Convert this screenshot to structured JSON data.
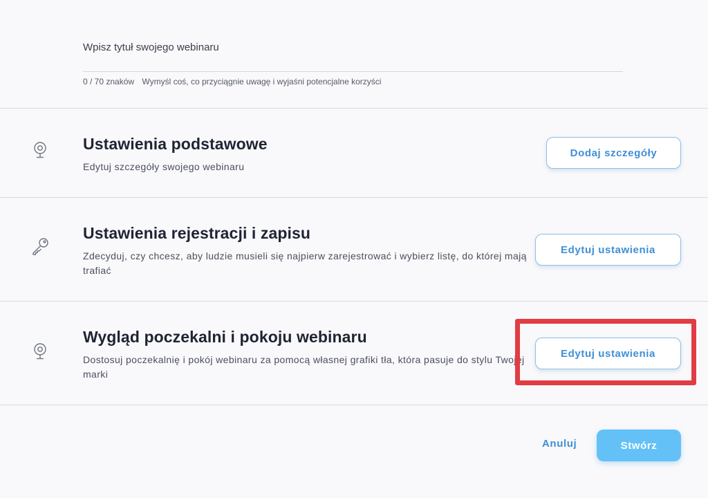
{
  "title_input": {
    "placeholder": "Wpisz tytuł swojego webinaru",
    "value": "",
    "counter": "0 / 70 znaków",
    "hint": "Wymyśl coś, co przyciągnie uwagę i wyjaśni potencjalne korzyści"
  },
  "sections": [
    {
      "icon": "webcam-icon",
      "title": "Ustawienia podstawowe",
      "description": "Edytuj szczegóły swojego webinaru",
      "button_label": "Dodaj szczegóły"
    },
    {
      "icon": "key-icon",
      "title": "Ustawienia rejestracji i zapisu",
      "description": "Zdecyduj, czy chcesz, aby ludzie musieli się najpierw zarejestrować i wybierz listę, do której mają trafiać",
      "button_label": "Edytuj ustawienia"
    },
    {
      "icon": "webcam-icon",
      "title": "Wygląd poczekalni i pokoju webinaru",
      "description": "Dostosuj poczekalnię i pokój webinaru za pomocą własnej grafiki tła, która pasuje do stylu Twojej marki",
      "button_label": "Edytuj ustawienia"
    }
  ],
  "footer": {
    "cancel_label": "Anuluj",
    "create_label": "Stwórz"
  },
  "colors": {
    "accent": "#3e8fd6",
    "primary_button": "#63c1f7",
    "highlight": "#e23c44",
    "background": "#f9f9fb"
  }
}
